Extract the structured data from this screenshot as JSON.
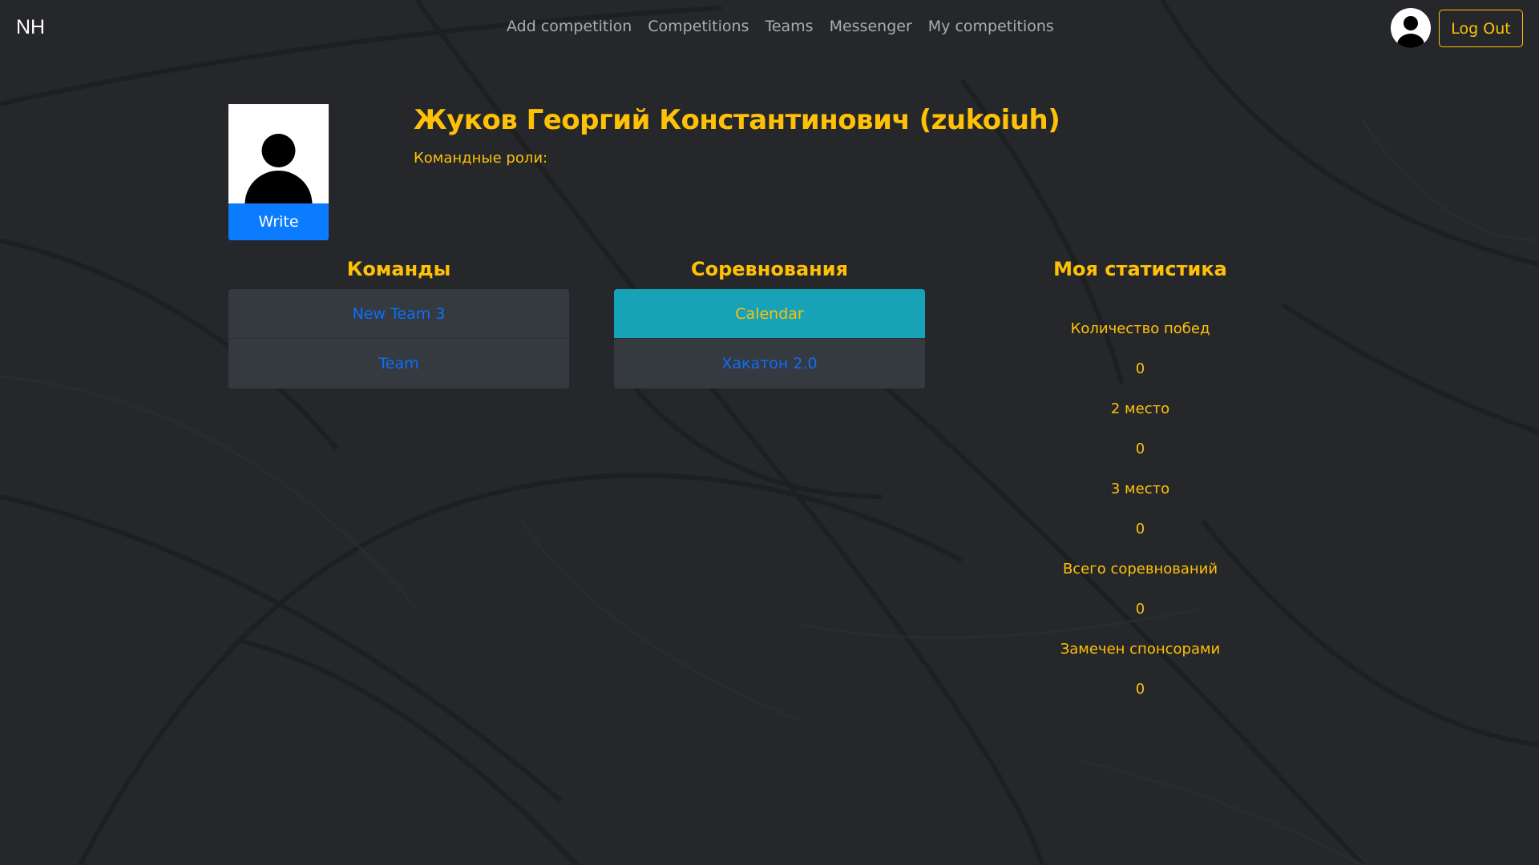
{
  "navbar": {
    "brand": "NH",
    "links": [
      {
        "label": "Add competition"
      },
      {
        "label": "Competitions"
      },
      {
        "label": "Teams"
      },
      {
        "label": "Messenger"
      },
      {
        "label": "My competitions"
      }
    ],
    "logout_label": "Log Out"
  },
  "profile": {
    "write_label": "Write",
    "name": "Жуков Георгий Константинович (zukoiuh)",
    "team_roles_label": "Командные роли:"
  },
  "teams": {
    "title": "Команды",
    "items": [
      {
        "label": "New Team 3"
      },
      {
        "label": "Team"
      }
    ]
  },
  "competitions": {
    "title": "Соревнования",
    "items": [
      {
        "label": "Calendar",
        "active": true
      },
      {
        "label": "Хакатон 2.0",
        "active": false
      }
    ]
  },
  "stats": {
    "title": "Моя статистика",
    "rows": [
      {
        "label": "Количество побед",
        "value": "0"
      },
      {
        "label": "2 место",
        "value": "0"
      },
      {
        "label": "3 место",
        "value": "0"
      },
      {
        "label": "Всего соревнований",
        "value": "0"
      },
      {
        "label": "Замечен спонсорами",
        "value": "0"
      }
    ]
  },
  "colors": {
    "background": "#26272a",
    "accent": "#ffc107",
    "primary": "#0b7bff",
    "active_item": "#17a2b8",
    "list_item": "#343a40",
    "link": "#0d6efd"
  },
  "icons": {
    "avatar": "user-silhouette-icon",
    "profile_photo": "user-silhouette-icon"
  }
}
